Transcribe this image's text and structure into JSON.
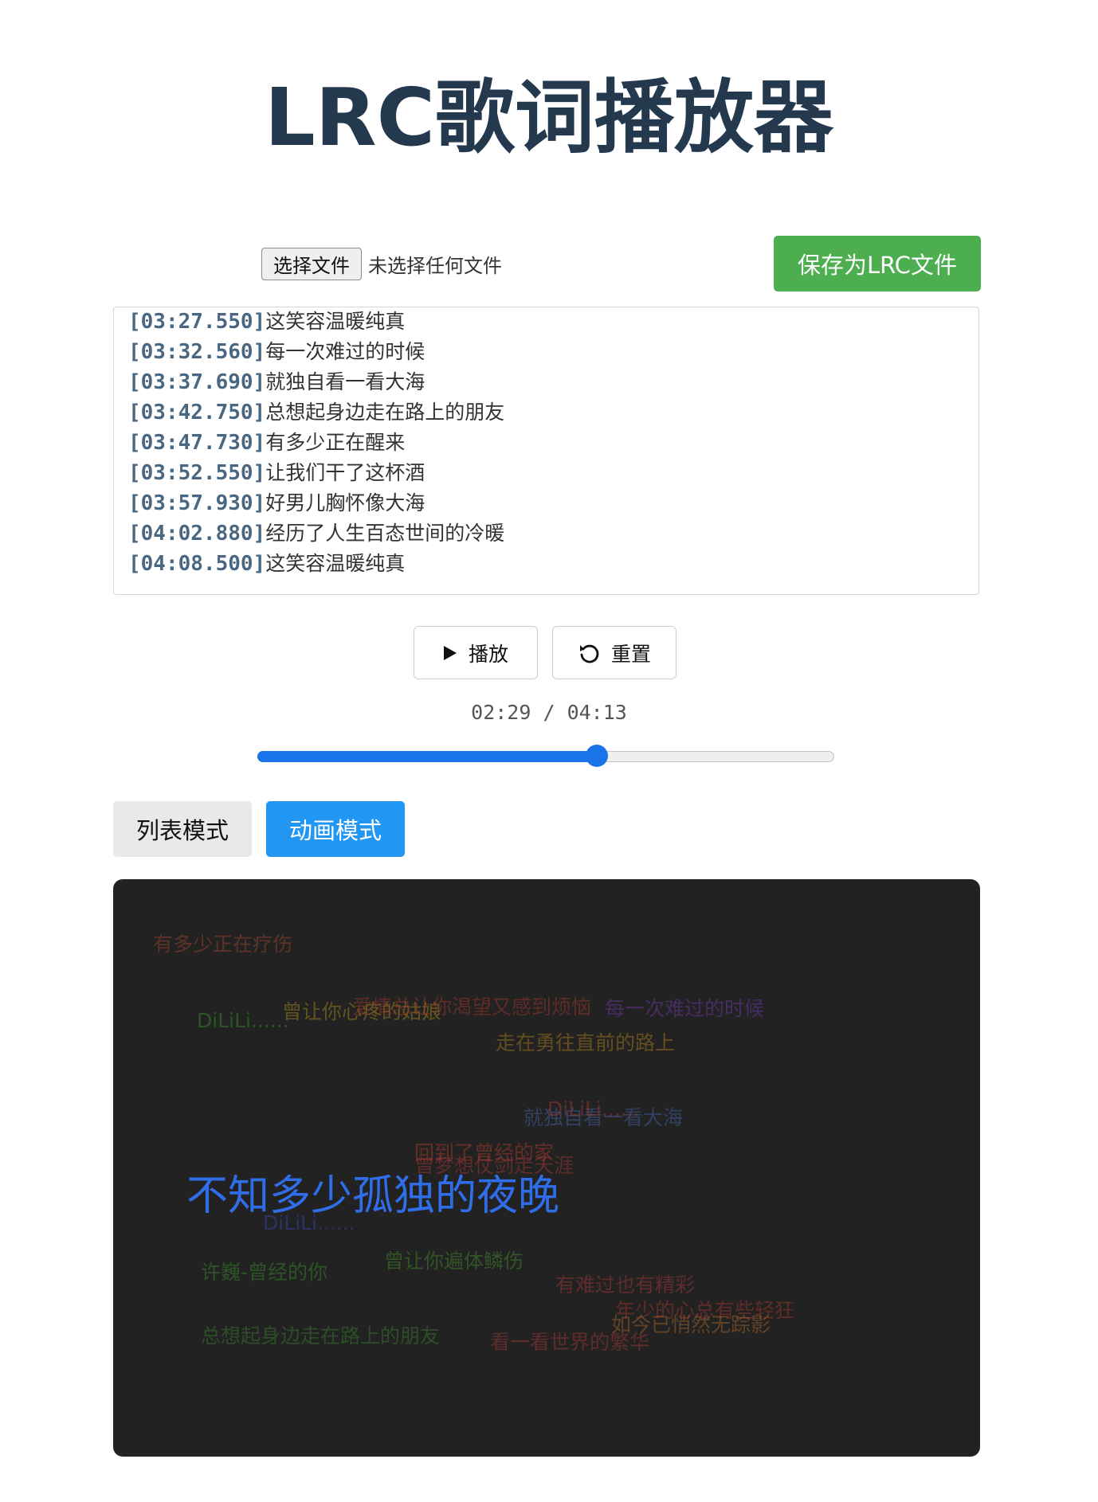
{
  "page": {
    "title": "LRC歌词播放器"
  },
  "file": {
    "button_label": "选择文件",
    "status": "未选择任何文件"
  },
  "save": {
    "label": "保存为LRC文件"
  },
  "lyrics": [
    {
      "time": "[03:27.550]",
      "text": "这笑容温暖纯真"
    },
    {
      "time": "[03:32.560]",
      "text": "每一次难过的时候"
    },
    {
      "time": "[03:37.690]",
      "text": "就独自看一看大海"
    },
    {
      "time": "[03:42.750]",
      "text": "总想起身边走在路上的朋友"
    },
    {
      "time": "[03:47.730]",
      "text": "有多少正在醒来"
    },
    {
      "time": "[03:52.550]",
      "text": "让我们干了这杯酒"
    },
    {
      "time": "[03:57.930]",
      "text": "好男儿胸怀像大海"
    },
    {
      "time": "[04:02.880]",
      "text": "经历了人生百态世间的冷暖"
    },
    {
      "time": "[04:08.500]",
      "text": "这笑容温暖纯真"
    }
  ],
  "controls": {
    "play_label": "播放",
    "reset_label": "重置",
    "time_display": "02:29 / 04:13",
    "progress_fraction": 0.588
  },
  "modes": {
    "list_label": "列表模式",
    "animation_label": "动画模式",
    "active": "动画模式"
  },
  "animation": {
    "current": {
      "text": "不知多少孤独的夜晚",
      "color": "#2f6ee8"
    },
    "floating": [
      {
        "text": "有多少正在疗伤",
        "color": "#b34a2e"
      },
      {
        "text": "DiLiLi......",
        "color": "#3a9a2e"
      },
      {
        "text": "曾让你心疼的姑娘",
        "color": "#b89a1e"
      },
      {
        "text": "爱情总让你渴望又感到烦恼",
        "color": "#b33a2e"
      },
      {
        "text": "每一次难过的时候",
        "color": "#7a3ab8"
      },
      {
        "text": "走在勇往直前的路上",
        "color": "#c08a1a"
      },
      {
        "text": "就独自看一看大海",
        "color": "#4a6ab8"
      },
      {
        "text": "DiLiLi......",
        "color": "#b33a3a"
      },
      {
        "text": "回到了曾经的家",
        "color": "#c0402e"
      },
      {
        "text": "曾梦想仗剑走天涯",
        "color": "#b33a3a"
      },
      {
        "text": "DiLiLi......",
        "color": "#3a4ac0"
      },
      {
        "text": "许巍-曾经的你",
        "color": "#3a9a2e"
      },
      {
        "text": "曾让你遍体鳞伤",
        "color": "#4a9a2e"
      },
      {
        "text": "有难过也有精彩",
        "color": "#b33a3a"
      },
      {
        "text": "年少的心总有些轻狂",
        "color": "#b33a2e"
      },
      {
        "text": "如今已悄然无踪影",
        "color": "#b8702e"
      },
      {
        "text": "总想起身边走在路上的朋友",
        "color": "#3a8a2e"
      },
      {
        "text": "看一看世界的繁华",
        "color": "#b33a3a"
      }
    ]
  }
}
